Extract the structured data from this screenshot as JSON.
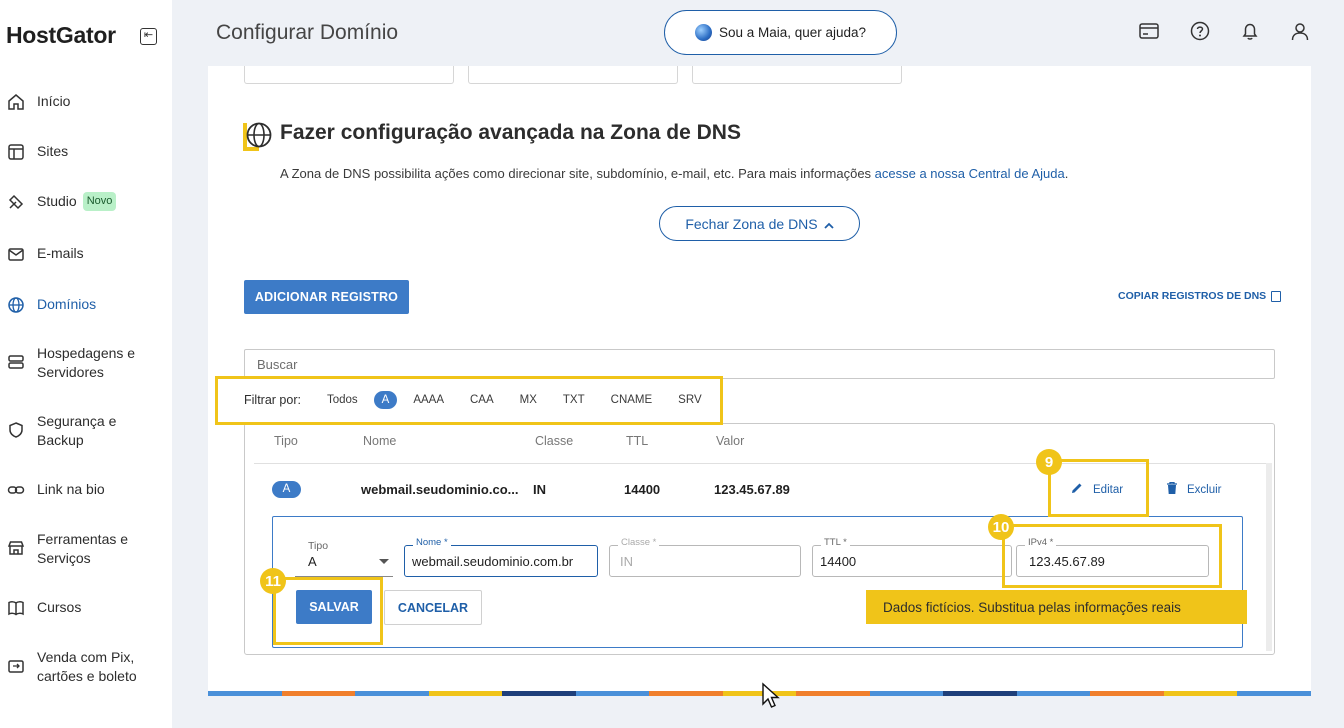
{
  "sidebar": {
    "logo": "HostGator",
    "items": [
      {
        "label": "Início",
        "icon": "home-icon"
      },
      {
        "label": "Sites",
        "icon": "layout-icon"
      },
      {
        "label": "Studio",
        "icon": "studio-icon",
        "badge": "Novo"
      },
      {
        "label": "E-mails",
        "icon": "mail-icon"
      },
      {
        "label": "Domínios",
        "icon": "globe-icon",
        "active": true
      },
      {
        "label": "Hospedagens e Servidores",
        "icon": "server-icon"
      },
      {
        "label": "Segurança e Backup",
        "icon": "shield-icon"
      },
      {
        "label": "Link na bio",
        "icon": "link-icon"
      },
      {
        "label": "Ferramentas e Serviços",
        "icon": "store-icon"
      },
      {
        "label": "Cursos",
        "icon": "book-icon"
      },
      {
        "label": "Venda com Pix, cartões e boleto",
        "icon": "payment-icon"
      }
    ]
  },
  "header": {
    "title": "Configurar Domínio",
    "assistant_label": "Sou a Maia, quer ajuda?",
    "icons": [
      "card-icon",
      "help-icon",
      "bell-icon",
      "user-icon"
    ]
  },
  "dns": {
    "title": "Fazer configuração avançada na Zona de DNS",
    "description": "A Zona de DNS possibilita ações como direcionar site, subdomínio, e-mail, etc. Para mais informações ",
    "help_link": "acesse a nossa Central de Ajuda",
    "description_end": ".",
    "close_zone_label": "Fechar Zona de DNS",
    "add_record_label": "ADICIONAR REGISTRO",
    "copy_records_label": "COPIAR REGISTROS DE DNS",
    "search_placeholder": "Buscar",
    "filter_label": "Filtrar por:",
    "filters": [
      "Todos",
      "A",
      "AAAA",
      "CAA",
      "MX",
      "TXT",
      "CNAME",
      "SRV"
    ],
    "active_filter": "A",
    "columns": [
      "Tipo",
      "Nome",
      "Classe",
      "TTL",
      "Valor"
    ],
    "row": {
      "type": "A",
      "name": "webmail.seudominio.co...",
      "class": "IN",
      "ttl": "14400",
      "value": "123.45.67.89",
      "edit_label": "Editar",
      "delete_label": "Excluir"
    },
    "form": {
      "type_label": "Tipo",
      "type_value": "A",
      "name_label": "Nome *",
      "name_value": "webmail.seudominio.com.br",
      "class_label": "Classe *",
      "class_value": "IN",
      "ttl_label": "TTL *",
      "ttl_value": "14400",
      "ipv4_label": "IPv4 *",
      "ipv4_value": "123.45.67.89",
      "save_label": "SALVAR",
      "cancel_label": "CANCELAR"
    }
  },
  "tutorial": {
    "steps": [
      "9",
      "10",
      "11"
    ],
    "note": "Dados fictícios. Substitua pelas informações reais",
    "highlight_color": "#f0c419"
  },
  "colors": {
    "accent": "#1f5fa8",
    "button": "#3d7bc7",
    "stripe_colors": [
      "#4a90d9",
      "#f07f2c",
      "#4a90d9",
      "#f0c419",
      "#1e3f7a",
      "#4a90d9",
      "#f07f2c",
      "#f0c419",
      "#f07f2c",
      "#4a90d9",
      "#1e3f7a",
      "#4a90d9",
      "#f07f2c",
      "#f0c419",
      "#4a90d9"
    ]
  }
}
